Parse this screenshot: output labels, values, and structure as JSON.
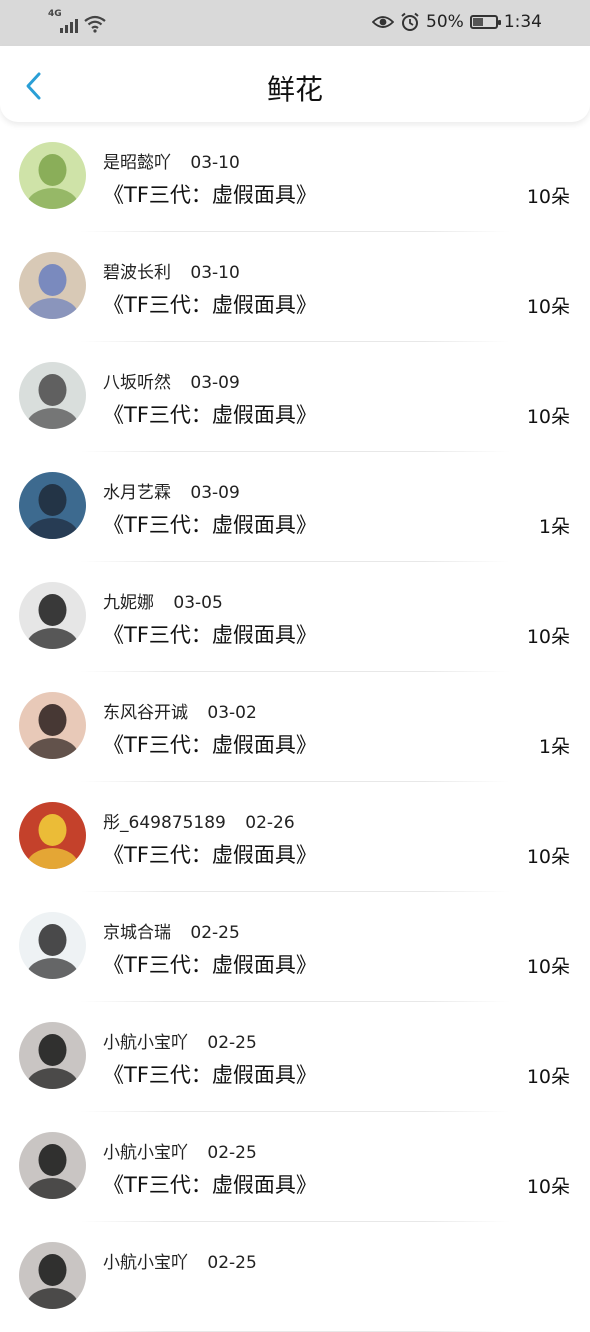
{
  "status_bar": {
    "network": "4G",
    "battery": "50%",
    "battery_level": 0.5,
    "time": "1:34",
    "icons": [
      "signal-icon",
      "wifi-icon",
      "eye-icon",
      "alarm-icon",
      "battery-icon"
    ]
  },
  "header": {
    "title": "鲜花",
    "back_icon": "chevron-left-icon",
    "accent": "#2a9fd6"
  },
  "records": [
    {
      "user": "是昭懿吖",
      "date": "03-10",
      "book": "《TF三代：虚假面具》",
      "count": "10朵",
      "avatar_colors": [
        "#cfe3a8",
        "#7ea54b"
      ]
    },
    {
      "user": "碧波长利",
      "date": "03-10",
      "book": "《TF三代：虚假面具》",
      "count": "10朵",
      "avatar_colors": [
        "#d8c9b6",
        "#6a7fbf"
      ]
    },
    {
      "user": "八坂听然",
      "date": "03-09",
      "book": "《TF三代：虚假面具》",
      "count": "10朵",
      "avatar_colors": [
        "#d9dedc",
        "#4a4a4a"
      ]
    },
    {
      "user": "水月艺霖",
      "date": "03-09",
      "book": "《TF三代：虚假面具》",
      "count": "1朵",
      "avatar_colors": [
        "#3d6a8f",
        "#1e2a3a"
      ]
    },
    {
      "user": "九妮娜",
      "date": "03-05",
      "book": "《TF三代：虚假面具》",
      "count": "10朵",
      "avatar_colors": [
        "#e6e6e6",
        "#1a1a1a"
      ]
    },
    {
      "user": "东风谷开诚",
      "date": "03-02",
      "book": "《TF三代：虚假面具》",
      "count": "1朵",
      "avatar_colors": [
        "#e8c9b8",
        "#2a1f1c"
      ]
    },
    {
      "user": "彤_649875189",
      "date": "02-26",
      "book": "《TF三代：虚假面具》",
      "count": "10朵",
      "avatar_colors": [
        "#c4412b",
        "#f2d23a"
      ]
    },
    {
      "user": "京城合瑞",
      "date": "02-25",
      "book": "《TF三代：虚假面具》",
      "count": "10朵",
      "avatar_colors": [
        "#eef2f4",
        "#2b2b2b"
      ]
    },
    {
      "user": "小航小宝吖",
      "date": "02-25",
      "book": "《TF三代：虚假面具》",
      "count": "10朵",
      "avatar_colors": [
        "#c9c5c3",
        "#151515"
      ]
    },
    {
      "user": "小航小宝吖",
      "date": "02-25",
      "book": "《TF三代：虚假面具》",
      "count": "10朵",
      "avatar_colors": [
        "#c9c5c3",
        "#151515"
      ]
    },
    {
      "user": "小航小宝吖",
      "date": "02-25",
      "book": "",
      "count": "",
      "avatar_colors": [
        "#c9c5c3",
        "#151515"
      ]
    }
  ]
}
